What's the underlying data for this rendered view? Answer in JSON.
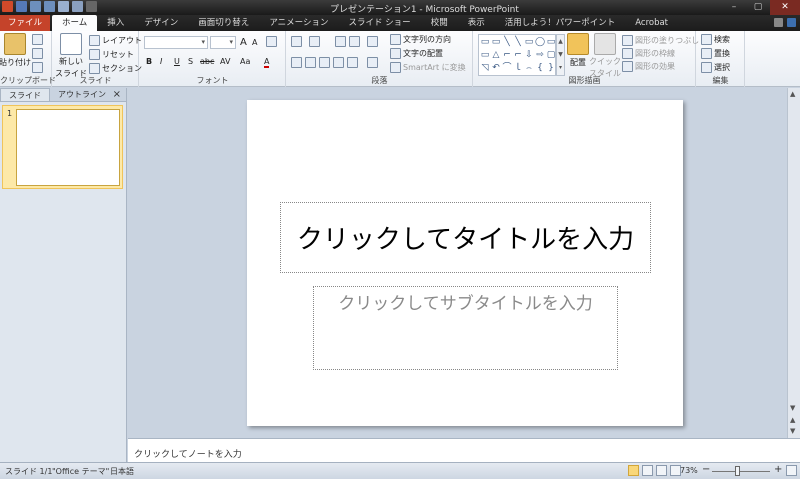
{
  "window": {
    "title": "プレゼンテーション1 - Microsoft PowerPoint",
    "min_label": "–",
    "max_label": "▢",
    "close_label": "✕"
  },
  "tabs": [
    {
      "label": "ファイル"
    },
    {
      "label": "ホーム"
    },
    {
      "label": "挿入"
    },
    {
      "label": "デザイン"
    },
    {
      "label": "画面切り替え"
    },
    {
      "label": "アニメーション"
    },
    {
      "label": "スライド ショー"
    },
    {
      "label": "校閲"
    },
    {
      "label": "表示"
    },
    {
      "label": "活用しよう！パワーポイント"
    },
    {
      "label": "Acrobat"
    }
  ],
  "ribbon": {
    "clipboard": {
      "paste": "貼り付け",
      "group": "クリップボード"
    },
    "slides": {
      "new_slide": "新しい",
      "new_slide2": "スライド",
      "layout": "レイアウト",
      "reset": "リセット",
      "section": "セクション",
      "group": "スライド"
    },
    "font": {
      "bold": "B",
      "italic": "I",
      "underline": "U",
      "strike": "S",
      "shadow": "abc",
      "spacing": "AV",
      "case": "Aa",
      "color": "A",
      "grow": "A",
      "shrink": "A",
      "group": "フォント"
    },
    "paragraph": {
      "text_direction": "文字列の方向",
      "align_text": "文字の配置",
      "smartart": "SmartArt に変換",
      "group": "段落"
    },
    "drawing": {
      "shapes": [
        "▭",
        "▭",
        "╲",
        "╲",
        "▭",
        "◯",
        "▭",
        "▭",
        "△",
        "⌐",
        "⌐",
        "⇩",
        "⇨",
        "▢",
        "◹",
        "↶",
        "⌒",
        "ｌ",
        "⌢",
        "{",
        "}"
      ],
      "arrange": "配置",
      "quick_style": "クイック",
      "quick_style2": "スタイル",
      "fill": "図形の塗りつぶし",
      "outline": "図形の枠線",
      "effects": "図形の効果",
      "group": "図形描画"
    },
    "editing": {
      "find": "検索",
      "replace": "置換",
      "select": "選択",
      "group": "編集"
    }
  },
  "left_pane": {
    "tab_slides": "スライド",
    "tab_outline": "アウトライン",
    "close": "×",
    "slide_number": "1"
  },
  "slide": {
    "title_placeholder": "クリックしてタイトルを入力",
    "subtitle_placeholder": "クリックしてサブタイトルを入力"
  },
  "notes": {
    "placeholder": "クリックしてノートを入力"
  },
  "status_bar": {
    "slide_info": "スライド 1/1",
    "theme": "\"Office テーマ\"",
    "language": "日本語",
    "zoom": "73%",
    "zoom_minus": "−",
    "zoom_plus": "+"
  },
  "colors": {
    "file_tab": "#c5432a",
    "selected_thumb": "#fde9a8"
  }
}
